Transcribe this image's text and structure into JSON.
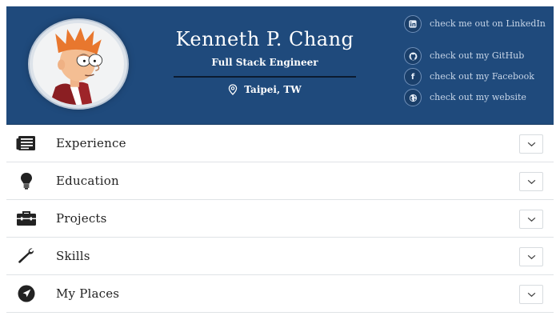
{
  "profile": {
    "name": "Kenneth P. Chang",
    "title": "Full Stack Engineer",
    "location": "Taipei, TW",
    "avatar_icon": "cartoon-avatar"
  },
  "social": [
    {
      "icon": "linkedin-icon",
      "glyph": "in",
      "label": "check me out on LinkedIn"
    },
    {
      "icon": "github-icon",
      "glyph": "●",
      "label": "check out my GitHub"
    },
    {
      "icon": "facebook-icon",
      "glyph": "f",
      "label": "check out my Facebook"
    },
    {
      "icon": "globe-icon",
      "glyph": "◍",
      "label": "check out my website"
    }
  ],
  "sections": [
    {
      "icon": "newspaper-icon",
      "label": "Experience"
    },
    {
      "icon": "lightbulb-icon",
      "label": "Education"
    },
    {
      "icon": "toolbox-icon",
      "label": "Projects"
    },
    {
      "icon": "wrench-icon",
      "label": "Skills"
    },
    {
      "icon": "compass-icon",
      "label": "My Places"
    }
  ],
  "colors": {
    "header_bg": "#1f4a7c",
    "social_text": "#c8d6e8"
  }
}
